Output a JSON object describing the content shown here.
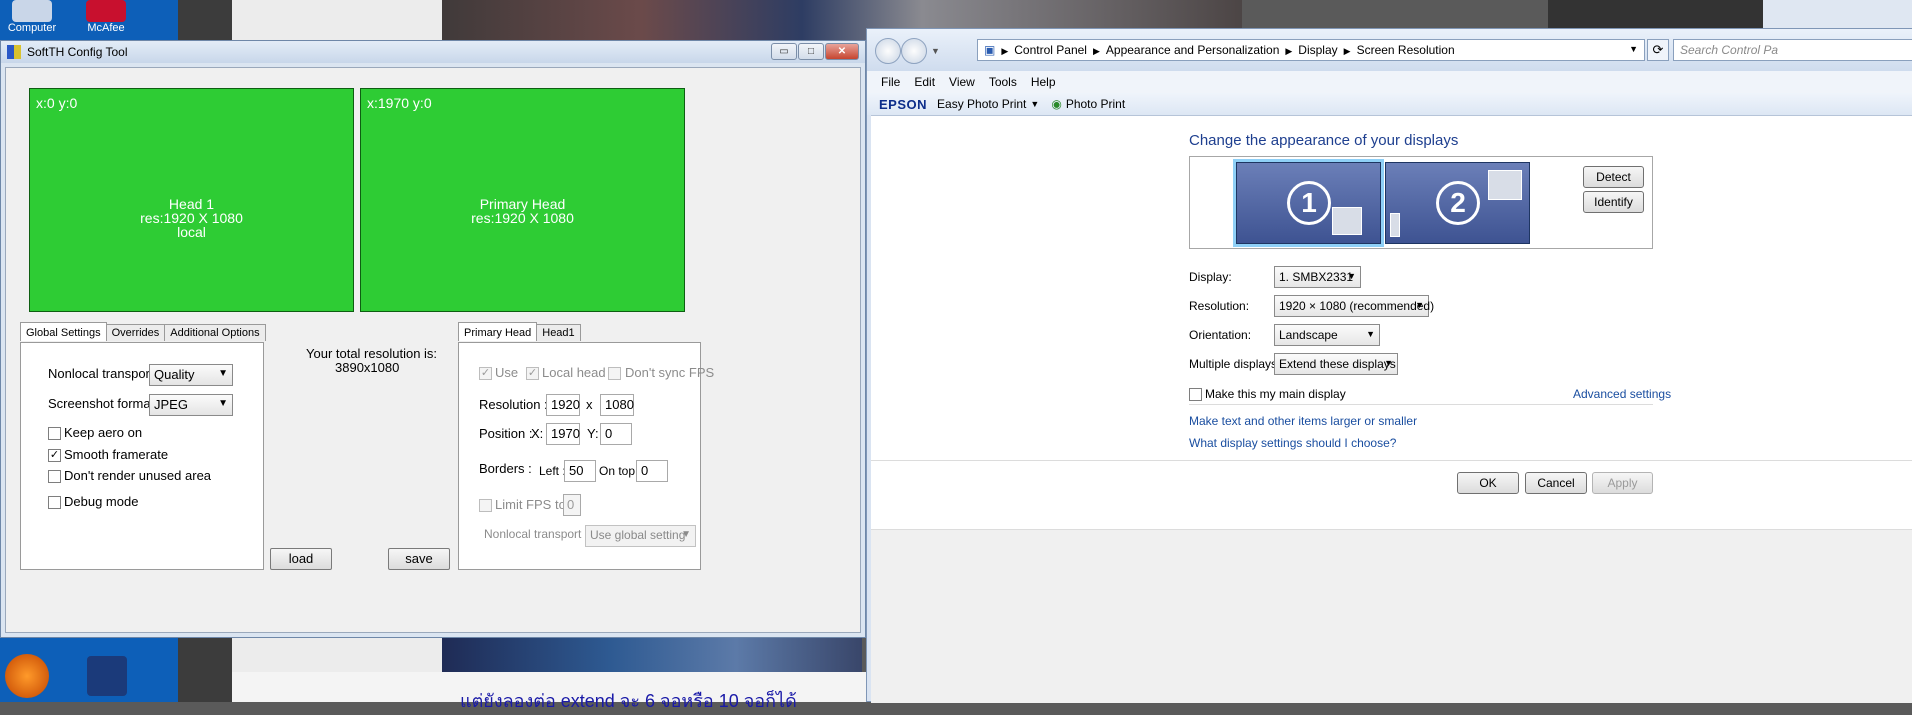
{
  "desktop": {
    "icons": [
      {
        "label": "Computer",
        "color": "#c9d6e8"
      },
      {
        "label": "McAfee",
        "color": "#c8102e"
      }
    ],
    "bottom_text": "แต่ยังลองต่อ extend จะ 6 จอหรือ 10 จอก็ได้"
  },
  "softth": {
    "title": "SoftTH Config Tool",
    "window_buttons": {
      "minimize": "▭",
      "maximize": "□",
      "close": "✕"
    },
    "heads": [
      {
        "coord": "x:0 y:0",
        "name": "Head 1",
        "res": "res:1920 X 1080",
        "extra": "local"
      },
      {
        "coord": "x:1970 y:0",
        "name": "Primary Head",
        "res": "res:1920 X 1080",
        "extra": ""
      }
    ],
    "left_tabs": [
      "Global Settings",
      "Overrides",
      "Additional Options"
    ],
    "global": {
      "nonlocal_transport_label": "Nonlocal transport :",
      "nonlocal_transport_value": "Quality",
      "screenshot_format_label": "Screenshot format :",
      "screenshot_format_value": "JPEG",
      "checkboxes": [
        {
          "label": "Keep aero on",
          "checked": false
        },
        {
          "label": "Smooth framerate",
          "checked": true
        },
        {
          "label": "Don't render unused area",
          "checked": false
        },
        {
          "label": "Debug mode",
          "checked": false
        }
      ]
    },
    "total_label": "Your total resolution is:",
    "total_value": "3890x1080",
    "load_label": "load",
    "save_label": "save",
    "right_tabs": [
      "Primary Head",
      "Head1"
    ],
    "head_settings": {
      "use_label": "Use",
      "local_head_label": "Local head",
      "dont_sync_label": "Don't sync FPS",
      "resolution_label": "Resolution :",
      "res_w": "1920",
      "x_sep": "x",
      "res_h": "1080",
      "position_label": "Position :",
      "pos_x_label": "X:",
      "pos_x": "1970",
      "pos_y_label": "Y:",
      "pos_y": "0",
      "borders_label": "Borders :",
      "left_label": "Left :",
      "left_value": "50",
      "on_top_label": "On top:",
      "on_top_value": "0",
      "limit_fps_label": "Limit FPS to",
      "limit_fps_value": "0",
      "nonlocal_label": "Nonlocal transport :",
      "nonlocal_value": "Use global setting"
    }
  },
  "cp": {
    "breadcrumb": [
      "Control Panel",
      "Appearance and Personalization",
      "Display",
      "Screen Resolution"
    ],
    "search_placeholder": "Search Control Pa",
    "menu": [
      "File",
      "Edit",
      "View",
      "Tools",
      "Help"
    ],
    "epson": {
      "logo": "EPSON",
      "easy_photo": "Easy Photo Print",
      "photo_print": "Photo Print"
    },
    "heading": "Change the appearance of your displays",
    "monitors": [
      "1",
      "2"
    ],
    "detect_label": "Detect",
    "identify_label": "Identify",
    "display_label": "Display:",
    "display_value": "1. SMBX2331",
    "resolution_label": "Resolution:",
    "resolution_value": "1920 × 1080 (recommended)",
    "orientation_label": "Orientation:",
    "orientation_value": "Landscape",
    "multiple_label": "Multiple displays:",
    "multiple_value": "Extend these displays",
    "main_display_label": "Make this my main display",
    "advanced_link": "Advanced settings",
    "link1": "Make text and other items larger or smaller",
    "link2": "What display settings should I choose?",
    "ok_label": "OK",
    "cancel_label": "Cancel",
    "apply_label": "Apply"
  }
}
